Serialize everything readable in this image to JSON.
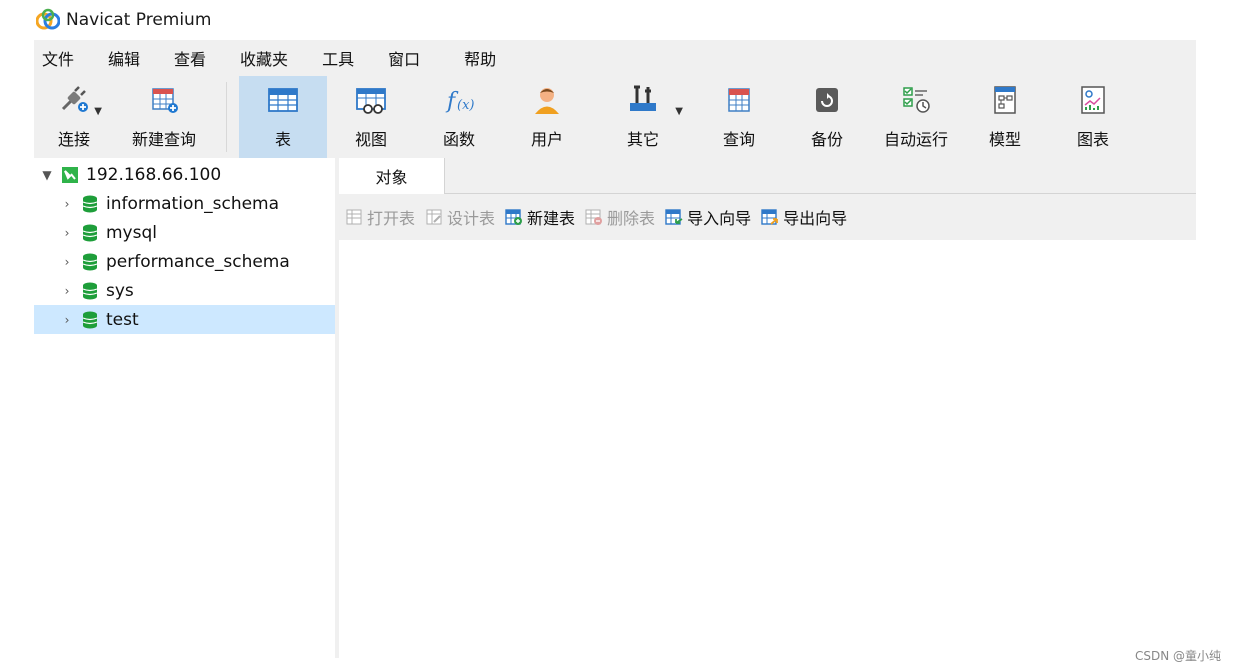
{
  "app": {
    "title": "Navicat Premium"
  },
  "menu": [
    "文件",
    "编辑",
    "查看",
    "收藏夹",
    "工具",
    "窗口",
    "帮助"
  ],
  "toolbar": {
    "connect": "连接",
    "new_query": "新建查询",
    "table": "表",
    "view": "视图",
    "function": "函数",
    "user": "用户",
    "other": "其它",
    "query": "查询",
    "backup": "备份",
    "automation": "自动运行",
    "model": "模型",
    "chart": "图表"
  },
  "tree": {
    "connection": "192.168.66.100",
    "databases": [
      "information_schema",
      "mysql",
      "performance_schema",
      "sys",
      "test"
    ],
    "selected": "test"
  },
  "tabs": [
    "对象"
  ],
  "object_toolbar": {
    "open_table": "打开表",
    "design_table": "设计表",
    "new_table": "新建表",
    "delete_table": "删除表",
    "import_wizard": "导入向导",
    "export_wizard": "导出向导"
  },
  "watermark": "CSDN @童小纯",
  "colors": {
    "toolbar_bg": "#f0f0f0",
    "active_tool": "#c6ddf1",
    "selected_row": "#cde8ff",
    "db_icon": "#1e9e3a",
    "connection_icon": "#2fb34a"
  }
}
